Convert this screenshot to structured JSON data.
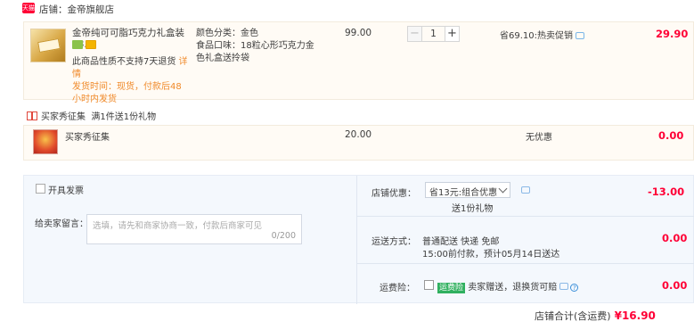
{
  "shop": {
    "badge": "天猫",
    "label": "店铺：金帝旗舰店"
  },
  "item": {
    "title": "金帝纯可可脂巧克力礼盒装18...",
    "policy_prefix": "此商品性质不支持7天退货 ",
    "policy_link": "详情",
    "delivery": "发货时间：现货，付款后48小时内发货",
    "sku_color": "颜色分类：金色",
    "sku_flavor": "食品口味：18粒心形巧克力金色礼盒送拎袋",
    "price": "99.00",
    "quantity": "1",
    "minus": "−",
    "plus": "+",
    "save": "省69.10:热卖促销",
    "total": "29.90"
  },
  "gift": {
    "section_label": "买家秀征集",
    "section_note": "满1件送1份礼物",
    "item_title": "买家秀征集",
    "price": "20.00",
    "discount": "无优惠",
    "total": "0.00"
  },
  "order": {
    "invoice_label": "开具发票",
    "message_label": "给卖家留言：",
    "message_placeholder": "选填，请先和商家协商一致，付款后商家可见",
    "message_count": "0/200",
    "shop_discount_label": "店铺优惠：",
    "shop_discount_value": "省13元:组合优惠",
    "shop_discount_gift": "送1份礼物",
    "shop_discount_amount": "-13.00",
    "shipping_label": "运送方式：",
    "shipping_method": "普通配送 快递 免邮",
    "shipping_eta": "15:00前付款，预计05月14日送达",
    "shipping_amount": "0.00",
    "insurance_label": "运费险：",
    "insurance_tag": "运费险",
    "insurance_text": "卖家赠送，退换货可赔",
    "insurance_help": "?",
    "insurance_amount": "0.00"
  },
  "footer": {
    "label": "店铺合计(含运费)",
    "amount": "¥16.90"
  },
  "colors": {
    "accent_red": "#ff0036",
    "orange_note": "#f08a2a",
    "panel_bg": "#f4f8fd"
  }
}
